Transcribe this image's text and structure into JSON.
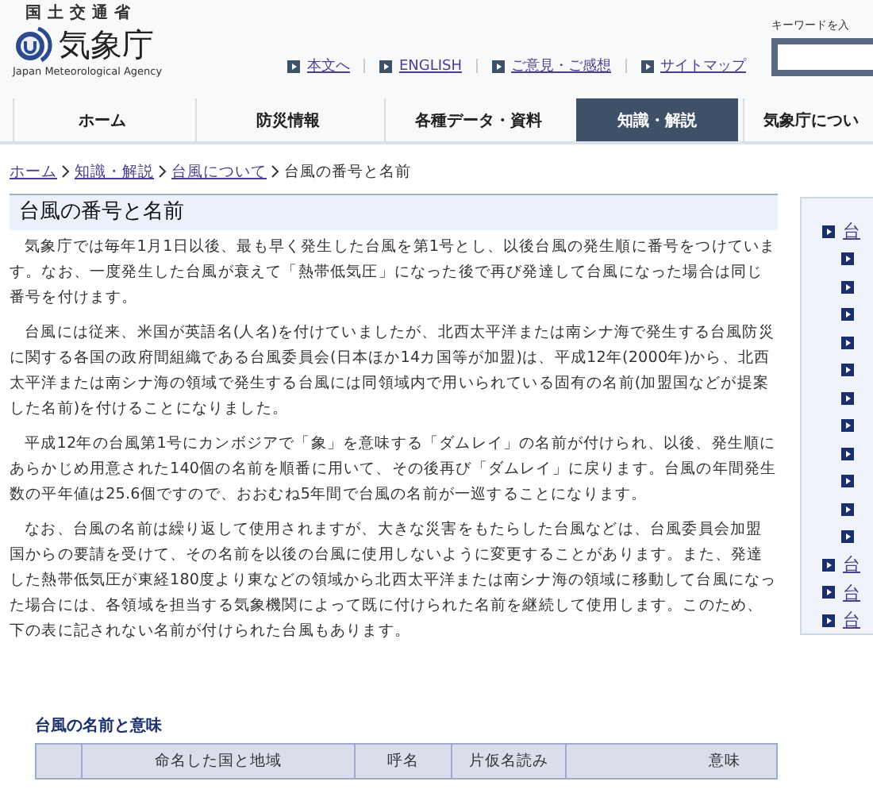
{
  "header": {
    "ministry": "国土交通省",
    "agency": "気象庁",
    "agency_en": "Japan Meteorological Agency",
    "links": [
      "本文へ",
      "ENGLISH",
      "ご意見・ご感想",
      "サイトマップ"
    ],
    "search_label": "キーワードを入"
  },
  "nav": [
    {
      "label": "ホーム",
      "selected": false
    },
    {
      "label": "防災情報",
      "selected": false
    },
    {
      "label": "各種データ・資料",
      "selected": false
    },
    {
      "label": "知識・解説",
      "selected": true
    },
    {
      "label": "気象庁につい",
      "selected": false
    }
  ],
  "breadcrumb": {
    "links": [
      "ホーム",
      "知識・解説",
      "台風について"
    ],
    "current": "台風の番号と名前"
  },
  "title": "台風の番号と名前",
  "paragraphs": [
    "気象庁では毎年1月1日以後、最も早く発生した台風を第1号とし、以後台風の発生順に番号をつけています。なお、一度発生した台風が衰えて「熱帯低気圧」になった後で再び発達して台風になった場合は同じ番号を付けます。",
    "台風には従来、米国が英語名(人名)を付けていましたが、北西太平洋または南シナ海で発生する台風防災に関する各国の政府間組織である台風委員会(日本ほか14カ国等が加盟)は、平成12年(2000年)から、北西太平洋または南シナ海の領域で発生する台風には同領域内で用いられている固有の名前(加盟国などが提案した名前)を付けることになりました。",
    "平成12年の台風第1号にカンボジアで「象」を意味する「ダムレイ」の名前が付けられ、以後、発生順にあらかじめ用意された140個の名前を順番に用いて、その後再び「ダムレイ」に戻ります。台風の年間発生数の平年値は25.6個ですので、おおむね5年間で台風の名前が一巡することになります。",
    "なお、台風の名前は繰り返して使用されますが、大きな災害をもたらした台風などは、台風委員会加盟国からの要請を受けて、その名前を以後の台風に使用しないように変更することがあります。また、発達した熱帯低気圧が東経180度より東などの領域から北西太平洋または南シナ海の領域に移動して台風になった場合には、各領域を担当する気象機関によって既に付けられた名前を継続して使用します。このため、下の表に記されない名前が付けられた台風もあります。"
  ],
  "sidebar": {
    "items": [
      {
        "label": "台",
        "children": [
          {
            "kind": "link"
          },
          {
            "kind": "link"
          },
          {
            "kind": "link"
          },
          {
            "kind": "link"
          },
          {
            "kind": "link"
          },
          {
            "kind": "link"
          },
          {
            "kind": "link"
          },
          {
            "kind": "link"
          },
          {
            "kind": "link"
          },
          {
            "kind": "link"
          },
          {
            "kind": "link"
          }
        ]
      },
      {
        "label": "台"
      },
      {
        "label": "台"
      },
      {
        "label": "台"
      }
    ]
  },
  "table": {
    "title": "台風の名前と意味",
    "columns": [
      "命名した国と地域",
      "呼名",
      "片仮名読み",
      "意味"
    ]
  }
}
